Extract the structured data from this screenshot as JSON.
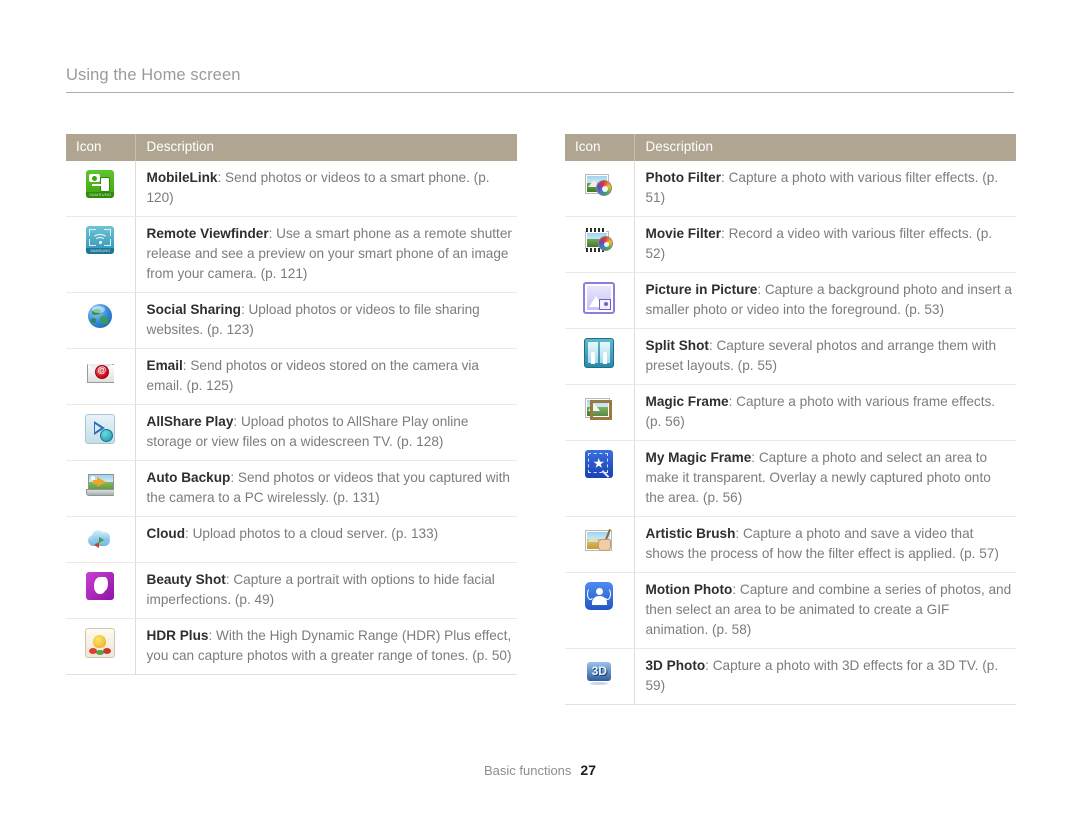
{
  "page": {
    "title": "Using the Home screen",
    "footer_label": "Basic functions",
    "footer_page": "27"
  },
  "colors": {
    "header_bg": "#b0a590",
    "header_text": "#ffffff",
    "title_text": "#9b9b9d",
    "body_text": "#7c7c7e",
    "term_text": "#2f2f31",
    "rule": "#adadaf"
  },
  "left_table": {
    "columns": [
      "Icon",
      "Description"
    ],
    "rows": [
      {
        "icon": "mobilelink-icon",
        "term": "MobileLink",
        "description": ": Send photos or videos to a smart phone. (p. 120)"
      },
      {
        "icon": "remote-viewfinder-icon",
        "term": "Remote Viewfinder",
        "description": ": Use a smart phone as a remote shutter release and see a preview on your smart phone of an image from your camera. (p. 121)"
      },
      {
        "icon": "social-sharing-globe-icon",
        "term": "Social Sharing",
        "description": ": Upload photos or videos to file sharing websites. (p. 123)"
      },
      {
        "icon": "email-envelope-icon",
        "term": "Email",
        "description": ": Send photos or videos stored on the camera via email. (p. 125)"
      },
      {
        "icon": "allshare-play-icon",
        "term": "AllShare Play",
        "description": ": Upload photos to AllShare Play online storage or view files on a widescreen TV. (p. 128)"
      },
      {
        "icon": "auto-backup-laptop-icon",
        "term": "Auto Backup",
        "description": ": Send photos or videos that you captured with the camera to a PC wirelessly. (p. 131)"
      },
      {
        "icon": "cloud-icon",
        "term": "Cloud",
        "description": ": Upload photos to a cloud server. (p. 133)"
      },
      {
        "icon": "beauty-shot-icon",
        "term": "Beauty Shot",
        "description": ": Capture a portrait with options to hide facial imperfections. (p. 49)"
      },
      {
        "icon": "hdr-plus-icon",
        "term": "HDR Plus",
        "description": ": With the High Dynamic Range (HDR) Plus effect, you can capture photos with a greater range of tones. (p. 50)"
      }
    ]
  },
  "right_table": {
    "columns": [
      "Icon",
      "Description"
    ],
    "rows": [
      {
        "icon": "photo-filter-icon",
        "term": "Photo Filter",
        "description": ": Capture a photo with various filter effects. (p. 51)"
      },
      {
        "icon": "movie-filter-icon",
        "term": "Movie Filter",
        "description": ": Record a video with various filter effects. (p. 52)"
      },
      {
        "icon": "picture-in-picture-icon",
        "term": "Picture in Picture",
        "description": ": Capture a background photo and insert a smaller photo or video into the foreground. (p. 53)"
      },
      {
        "icon": "split-shot-icon",
        "term": "Split Shot",
        "description": ": Capture several photos and arrange them with preset layouts. (p. 55)"
      },
      {
        "icon": "magic-frame-icon",
        "term": "Magic Frame",
        "description": ": Capture a photo with various frame effects. (p. 56)"
      },
      {
        "icon": "my-magic-frame-icon",
        "term": "My Magic Frame",
        "description": ": Capture a photo and select an area to make it transparent. Overlay a newly captured photo onto the area. (p. 56)"
      },
      {
        "icon": "artistic-brush-icon",
        "term": "Artistic Brush",
        "description": ": Capture a photo and save a video that shows the process of how the filter effect is applied. (p. 57)"
      },
      {
        "icon": "motion-photo-icon",
        "term": "Motion Photo",
        "description": ": Capture and combine a series of photos, and then select an area to be animated to create a GIF animation. (p. 58)"
      },
      {
        "icon": "three-d-photo-icon",
        "term": "3D Photo",
        "description": ": Capture a photo with 3D effects for a 3D TV. (p. 59)"
      }
    ]
  },
  "icon_labels": {
    "mobilelink_brand": "SAMSUNG",
    "remote_viewfinder_brand": "SAMSUNG",
    "three_d_label": "3D"
  }
}
